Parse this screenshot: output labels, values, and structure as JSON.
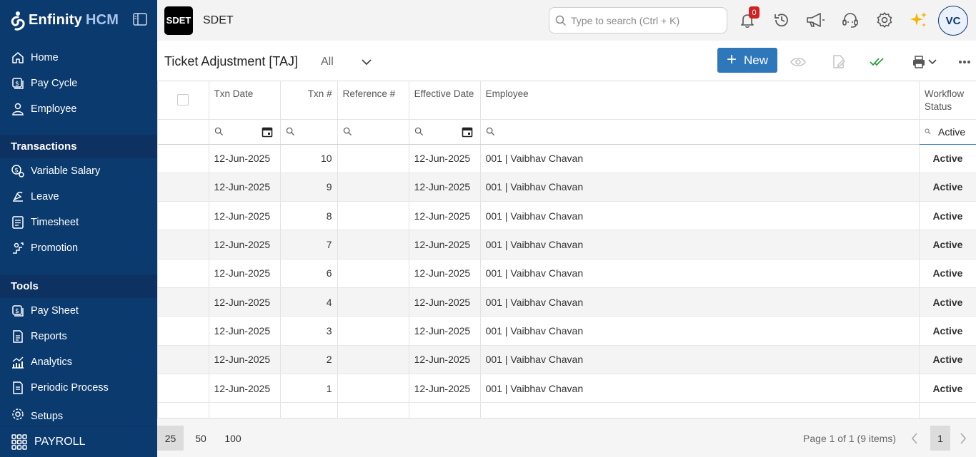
{
  "sidebar": {
    "brand": {
      "name": "Enfinity",
      "suffix": "HCM"
    },
    "main_items": [
      {
        "label": "Home",
        "icon": "home-icon"
      },
      {
        "label": "Pay Cycle",
        "icon": "pay-cycle-icon"
      },
      {
        "label": "Employee",
        "icon": "employee-icon"
      }
    ],
    "sections": [
      {
        "title": "Transactions",
        "items": [
          {
            "label": "Variable Salary",
            "icon": "variable-salary-icon"
          },
          {
            "label": "Leave",
            "icon": "leave-icon"
          },
          {
            "label": "Timesheet",
            "icon": "timesheet-icon"
          },
          {
            "label": "Promotion",
            "icon": "promotion-icon"
          }
        ]
      },
      {
        "title": "Tools",
        "items": [
          {
            "label": "Pay Sheet",
            "icon": "pay-sheet-icon"
          },
          {
            "label": "Reports",
            "icon": "reports-icon"
          },
          {
            "label": "Analytics",
            "icon": "analytics-icon"
          },
          {
            "label": "Periodic Process",
            "icon": "periodic-process-icon"
          },
          {
            "label": "Setups",
            "icon": "setups-icon"
          }
        ]
      }
    ],
    "footer_label": "PAYROLL"
  },
  "topbar": {
    "company_logo_text": "SDET",
    "company_name": "SDET",
    "search_placeholder": "Type to search (Ctrl + K)",
    "notification_count": "0",
    "avatar_initials": "VC"
  },
  "page": {
    "title": "Ticket Adjustment [TAJ]",
    "filter_value": "All",
    "new_label": "New"
  },
  "grid": {
    "columns": {
      "txn_date": "Txn Date",
      "txn_no": "Txn #",
      "reference": "Reference #",
      "effective_date": "Effective Date",
      "employee": "Employee",
      "workflow_status": "Workflow Status"
    },
    "status_filter_value": "Active",
    "rows": [
      {
        "txn_date": "12-Jun-2025",
        "txn_no": "10",
        "reference": "",
        "effective_date": "12-Jun-2025",
        "employee": "001 | Vaibhav Chavan",
        "status": "Active"
      },
      {
        "txn_date": "12-Jun-2025",
        "txn_no": "9",
        "reference": "",
        "effective_date": "12-Jun-2025",
        "employee": "001 | Vaibhav Chavan",
        "status": "Active"
      },
      {
        "txn_date": "12-Jun-2025",
        "txn_no": "8",
        "reference": "",
        "effective_date": "12-Jun-2025",
        "employee": "001 | Vaibhav Chavan",
        "status": "Active"
      },
      {
        "txn_date": "12-Jun-2025",
        "txn_no": "7",
        "reference": "",
        "effective_date": "12-Jun-2025",
        "employee": "001 | Vaibhav Chavan",
        "status": "Active"
      },
      {
        "txn_date": "12-Jun-2025",
        "txn_no": "6",
        "reference": "",
        "effective_date": "12-Jun-2025",
        "employee": "001 | Vaibhav Chavan",
        "status": "Active"
      },
      {
        "txn_date": "12-Jun-2025",
        "txn_no": "4",
        "reference": "",
        "effective_date": "12-Jun-2025",
        "employee": "001 | Vaibhav Chavan",
        "status": "Active"
      },
      {
        "txn_date": "12-Jun-2025",
        "txn_no": "3",
        "reference": "",
        "effective_date": "12-Jun-2025",
        "employee": "001 | Vaibhav Chavan",
        "status": "Active"
      },
      {
        "txn_date": "12-Jun-2025",
        "txn_no": "2",
        "reference": "",
        "effective_date": "12-Jun-2025",
        "employee": "001 | Vaibhav Chavan",
        "status": "Active"
      },
      {
        "txn_date": "12-Jun-2025",
        "txn_no": "1",
        "reference": "",
        "effective_date": "12-Jun-2025",
        "employee": "001 | Vaibhav Chavan",
        "status": "Active"
      }
    ]
  },
  "pager": {
    "page_sizes": [
      "25",
      "50",
      "100"
    ],
    "selected_size": "25",
    "info": "Page 1 of 1 (9 items)",
    "current_page": "1"
  }
}
